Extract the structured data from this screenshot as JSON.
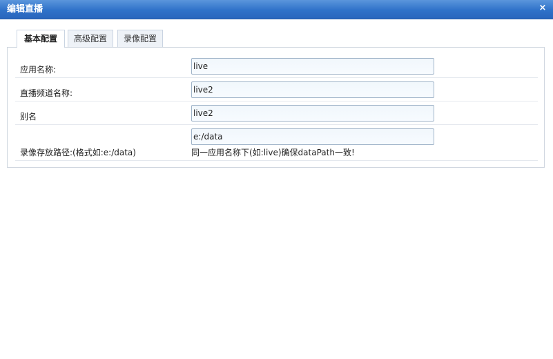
{
  "window": {
    "title": "编辑直播",
    "close_glyph": "×"
  },
  "tabs": [
    {
      "label": "基本配置",
      "active": true
    },
    {
      "label": "高级配置",
      "active": false
    },
    {
      "label": "录像配置",
      "active": false
    }
  ],
  "form": {
    "rows": [
      {
        "label": "应用名称:",
        "value": "live"
      },
      {
        "label": "直播频道名称:",
        "value": "live2"
      },
      {
        "label": "别名",
        "value": "live2"
      },
      {
        "label": "录像存放路径:(格式如:e:/data)",
        "value": "e:/data",
        "hint": "同一应用名称下(如:live)确保dataPath一致!"
      }
    ]
  },
  "colors": {
    "titlebar": "#2f72c9",
    "input_bg": "#f1f7fc",
    "input_border": "#9fb3c8"
  }
}
